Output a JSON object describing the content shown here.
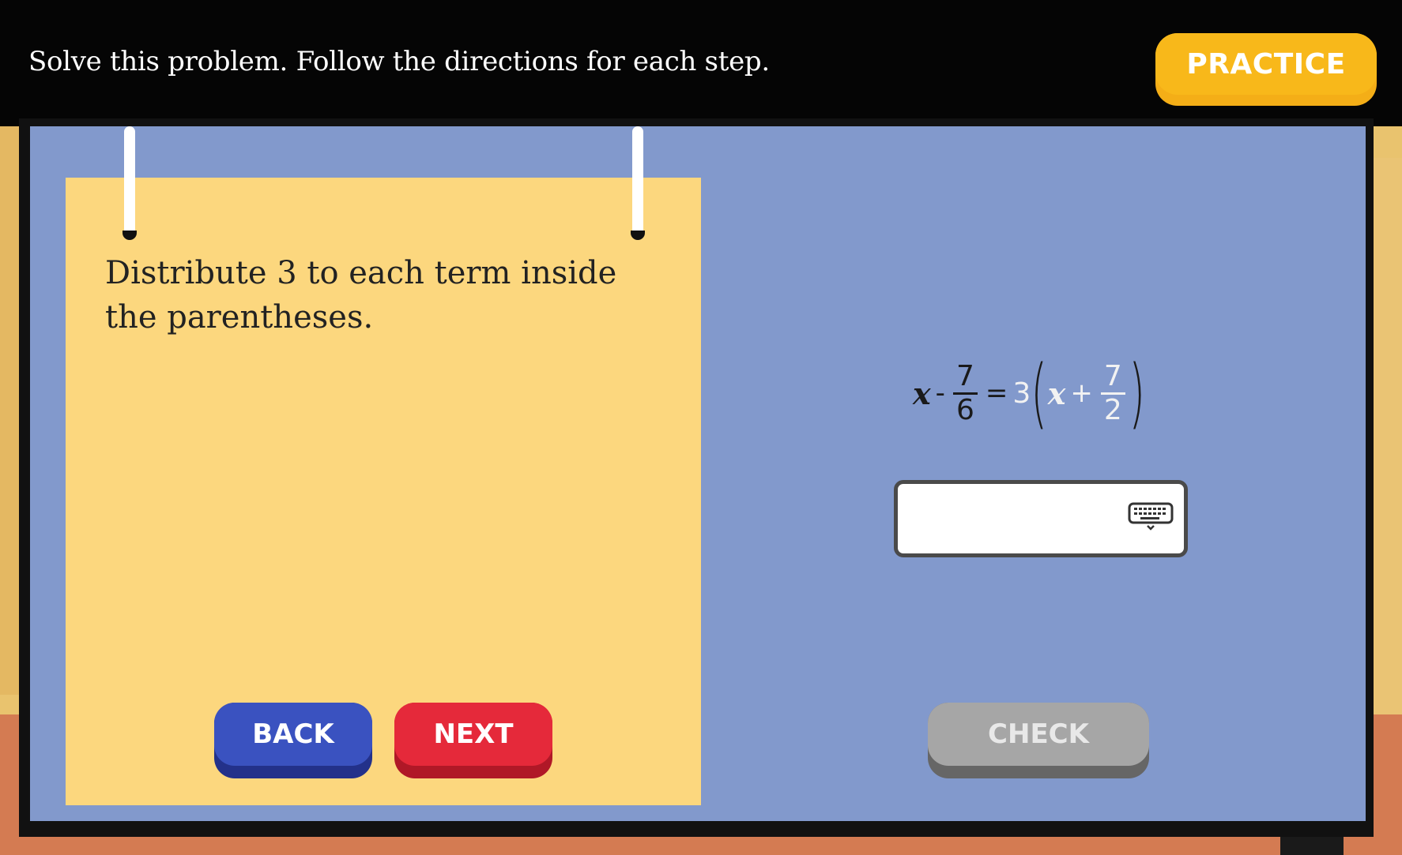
{
  "header": {
    "instruction": "Solve this problem. Follow the directions for each step.",
    "practice_label": "PRACTICE"
  },
  "note": {
    "text": "Distribute 3 to each term inside the parentheses."
  },
  "equation": {
    "lhs_var": "x",
    "lhs_op": "-",
    "lhs_frac_num": "7",
    "lhs_frac_den": "6",
    "equals": "=",
    "coefficient": "3",
    "rhs_var": "x",
    "rhs_op": "+",
    "rhs_frac_num": "7",
    "rhs_frac_den": "2"
  },
  "answer": {
    "value": "",
    "keyboard_icon": "keyboard-icon"
  },
  "buttons": {
    "back_label": "BACK",
    "next_label": "NEXT",
    "check_label": "CHECK"
  },
  "colors": {
    "board": "#8299cc",
    "note": "#fcd77e",
    "practice": "#f8b81a",
    "back": "#3a52c0",
    "next": "#e5293a",
    "check_disabled": "#a6a6a6"
  }
}
